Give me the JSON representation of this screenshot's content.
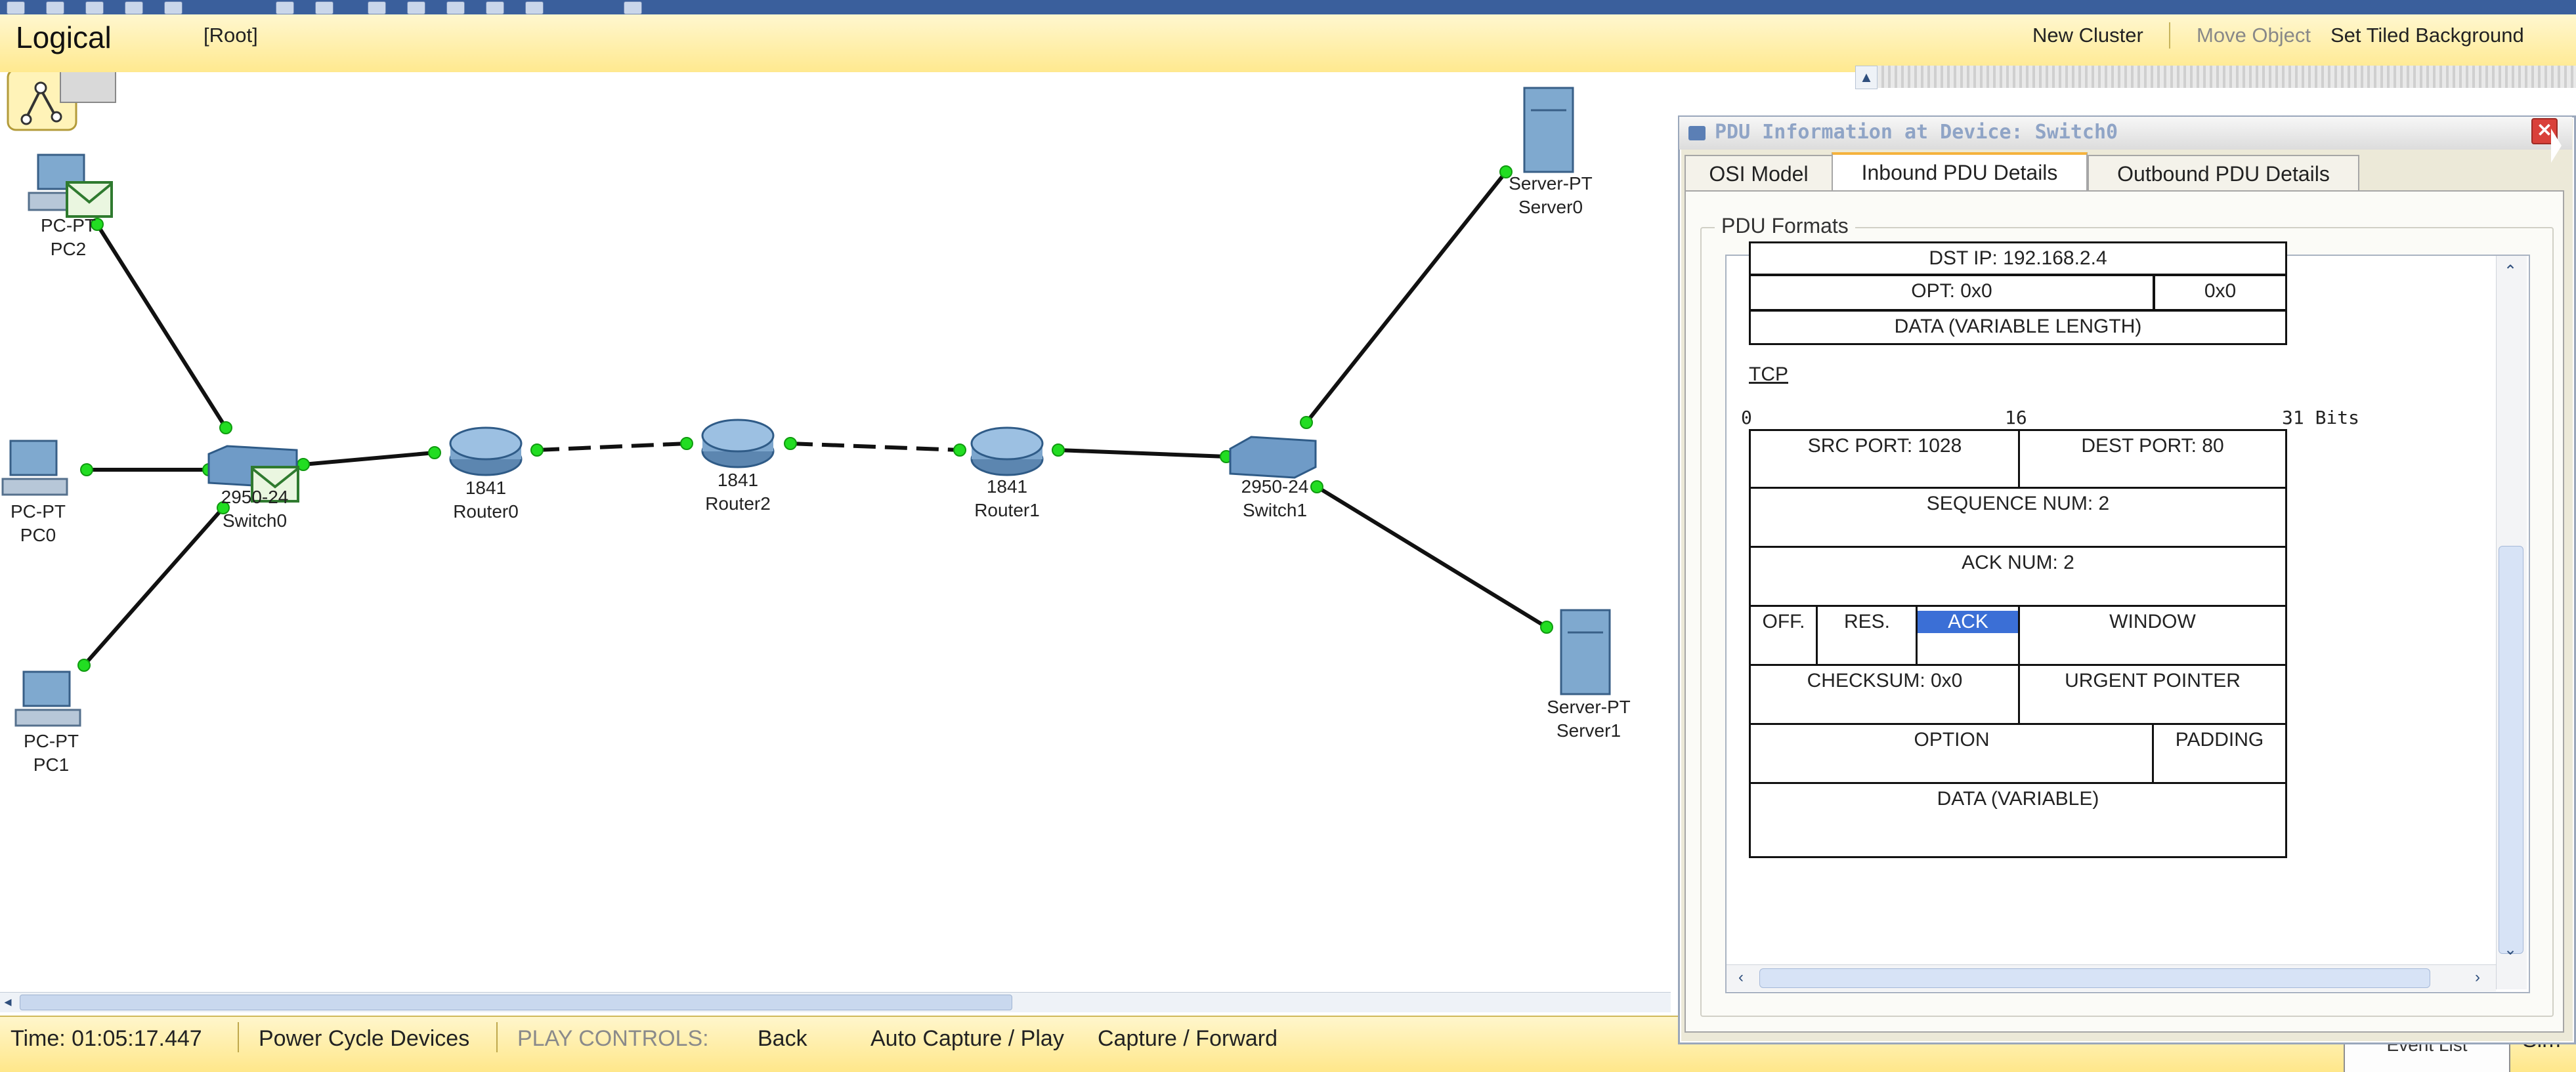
{
  "workspace": {
    "mode": "Logical",
    "root": "[Root]",
    "new_cluster": "New Cluster",
    "move_object": "Move Object",
    "set_tiled_background": "Set Tiled Background"
  },
  "devices": [
    {
      "id": "pc2",
      "model": "PC-PT",
      "name": "PC2"
    },
    {
      "id": "pc0",
      "model": "PC-PT",
      "name": "PC0"
    },
    {
      "id": "pc1",
      "model": "PC-PT",
      "name": "PC1"
    },
    {
      "id": "switch0",
      "model": "2950-24",
      "name": "Switch0"
    },
    {
      "id": "router0",
      "model": "1841",
      "name": "Router0"
    },
    {
      "id": "router2",
      "model": "1841",
      "name": "Router2"
    },
    {
      "id": "router1",
      "model": "1841",
      "name": "Router1"
    },
    {
      "id": "switch1",
      "model": "2950-24",
      "name": "Switch1"
    },
    {
      "id": "server0",
      "model": "Server-PT",
      "name": "Server0"
    },
    {
      "id": "server1",
      "model": "Server-PT",
      "name": "Server1"
    }
  ],
  "dialog": {
    "title": "PDU Information at Device: Switch0",
    "close_symbol": "✕",
    "tabs": [
      "OSI Model",
      "Inbound PDU Details",
      "Outbound PDU Details"
    ],
    "active_tab": "Inbound PDU Details",
    "group_label": "PDU Formats",
    "ip_partial": {
      "dst_ip": "DST IP: 192.168.2.4",
      "opt": "OPT: 0x0",
      "opt_pad": "0x0",
      "data": "DATA (VARIABLE LENGTH)"
    },
    "tcp": {
      "label": "TCP",
      "bit_0": "0",
      "bit_16": "16",
      "bit_31": "31  Bits",
      "src_port": "SRC PORT: 1028",
      "dest_port": "DEST PORT: 80",
      "sequence": "SEQUENCE NUM: 2",
      "ack_num": "ACK NUM: 2",
      "off": "OFF.",
      "res": "RES.",
      "flags": "ACK",
      "window": "WINDOW",
      "checksum": "CHECKSUM: 0x0",
      "urgent": "URGENT POINTER",
      "option": "OPTION",
      "padding": "PADDING",
      "data": "DATA (VARIABLE)"
    }
  },
  "bottom": {
    "time": "Time: 01:05:17.447",
    "power_cycle": "Power Cycle Devices",
    "play_controls": "PLAY CONTROLS:",
    "back": "Back",
    "auto_capture": "Auto Capture / Play",
    "capture_forward": "Capture / Forward",
    "event_list": "Event List",
    "sim_tab": "Sim"
  },
  "colors": {
    "link_green": "#22dd22",
    "link_black": "#111111",
    "workspace_bar": "#ffe98f",
    "ack_highlight": "#3b6fd6"
  }
}
